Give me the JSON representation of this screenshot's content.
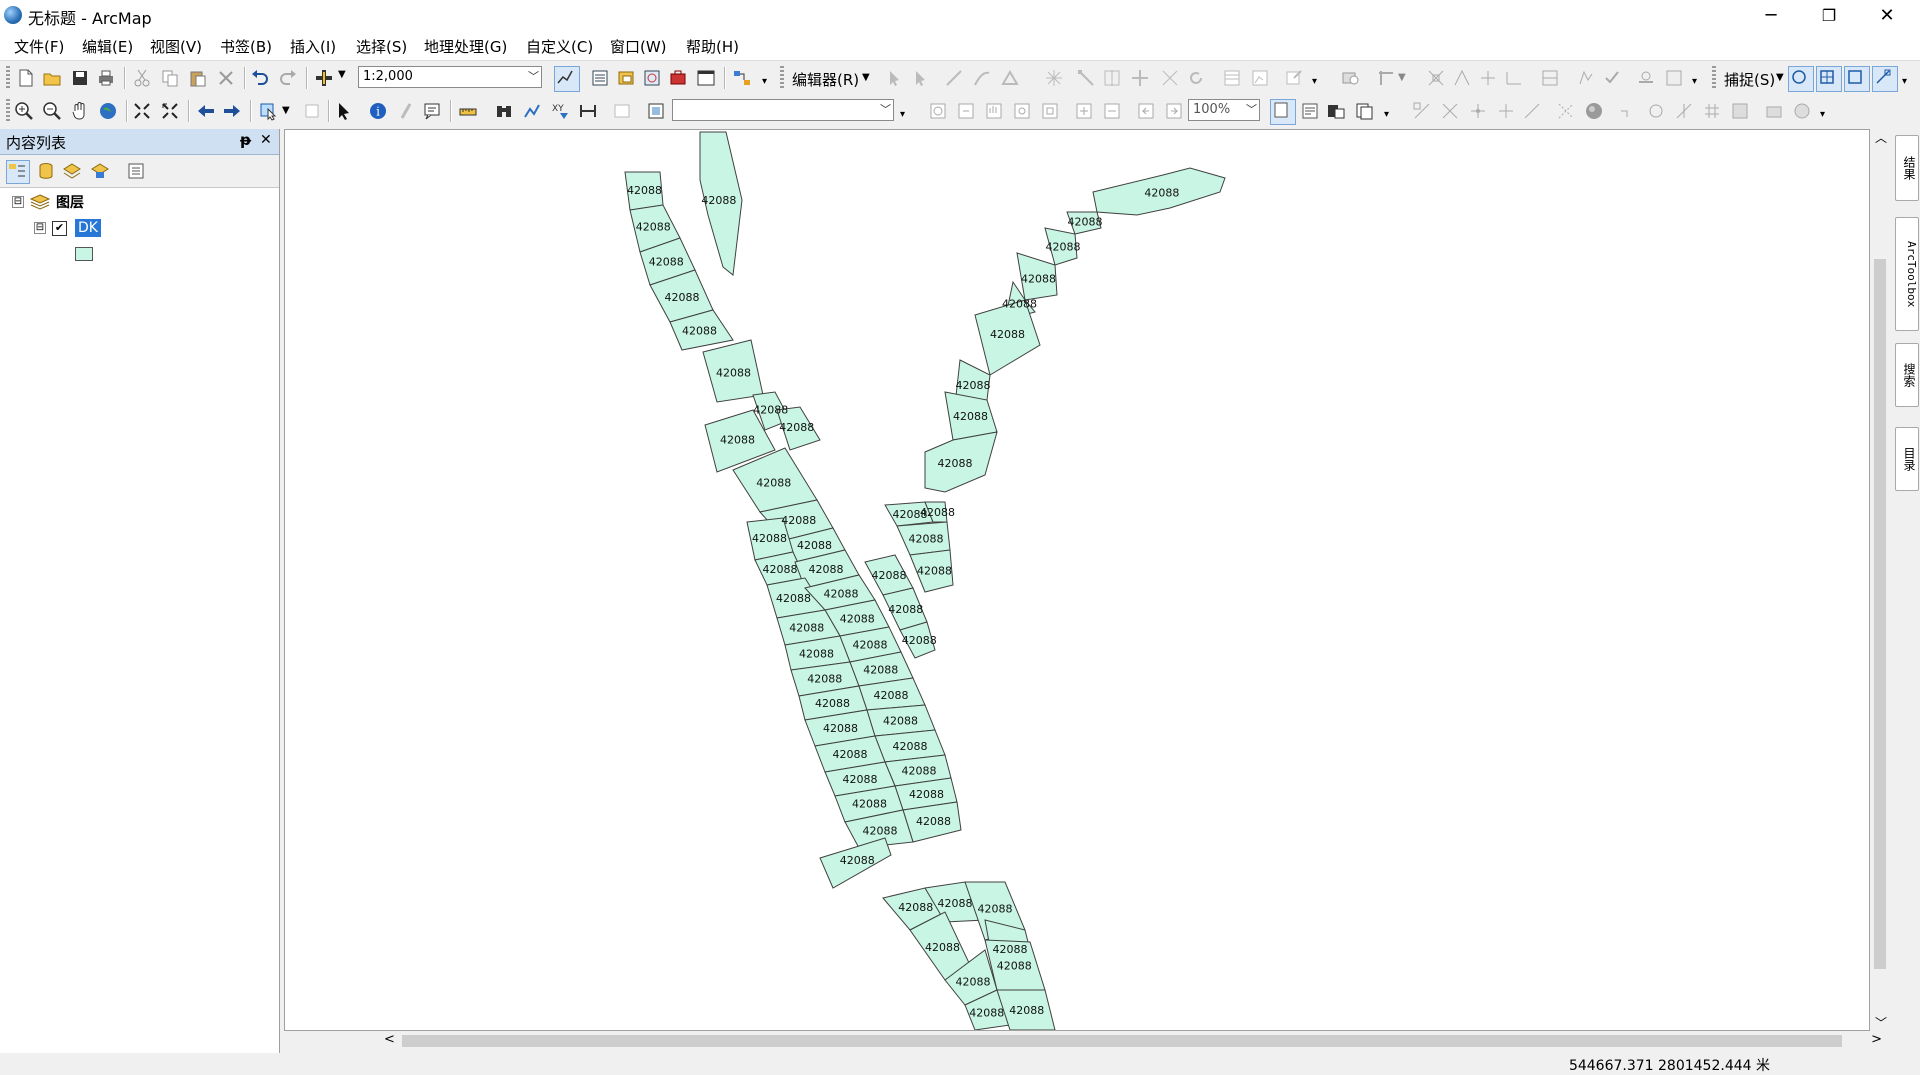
{
  "window": {
    "title": "无标题 - ArcMap",
    "minimize": "─",
    "restore": "❐",
    "close": "✕"
  },
  "menu": [
    "文件(F)",
    "编辑(E)",
    "视图(V)",
    "书签(B)",
    "插入(I)",
    "选择(S)",
    "地理处理(G)",
    "自定义(C)",
    "窗口(W)",
    "帮助(H)"
  ],
  "toolbar": {
    "scale": "1:2,000",
    "editor": "编辑器(R)",
    "snapping": "捕捉(S)",
    "zoom": "100%",
    "layer_combo": ""
  },
  "toc": {
    "title": "内容列表",
    "pin": "ᵽ",
    "close": "✕",
    "root_layer": "图层",
    "layer": "DK",
    "layer_checked": true,
    "expanders": [
      "⊟",
      "⊟"
    ]
  },
  "right_dock": [
    "结果",
    "ArcToolbox",
    "搜索",
    "目录"
  ],
  "status": {
    "coordinates": "544667.371  2801452.444 米"
  },
  "map": {
    "parcel_fill": "#c8f5e4",
    "parcel_label": "42088"
  }
}
